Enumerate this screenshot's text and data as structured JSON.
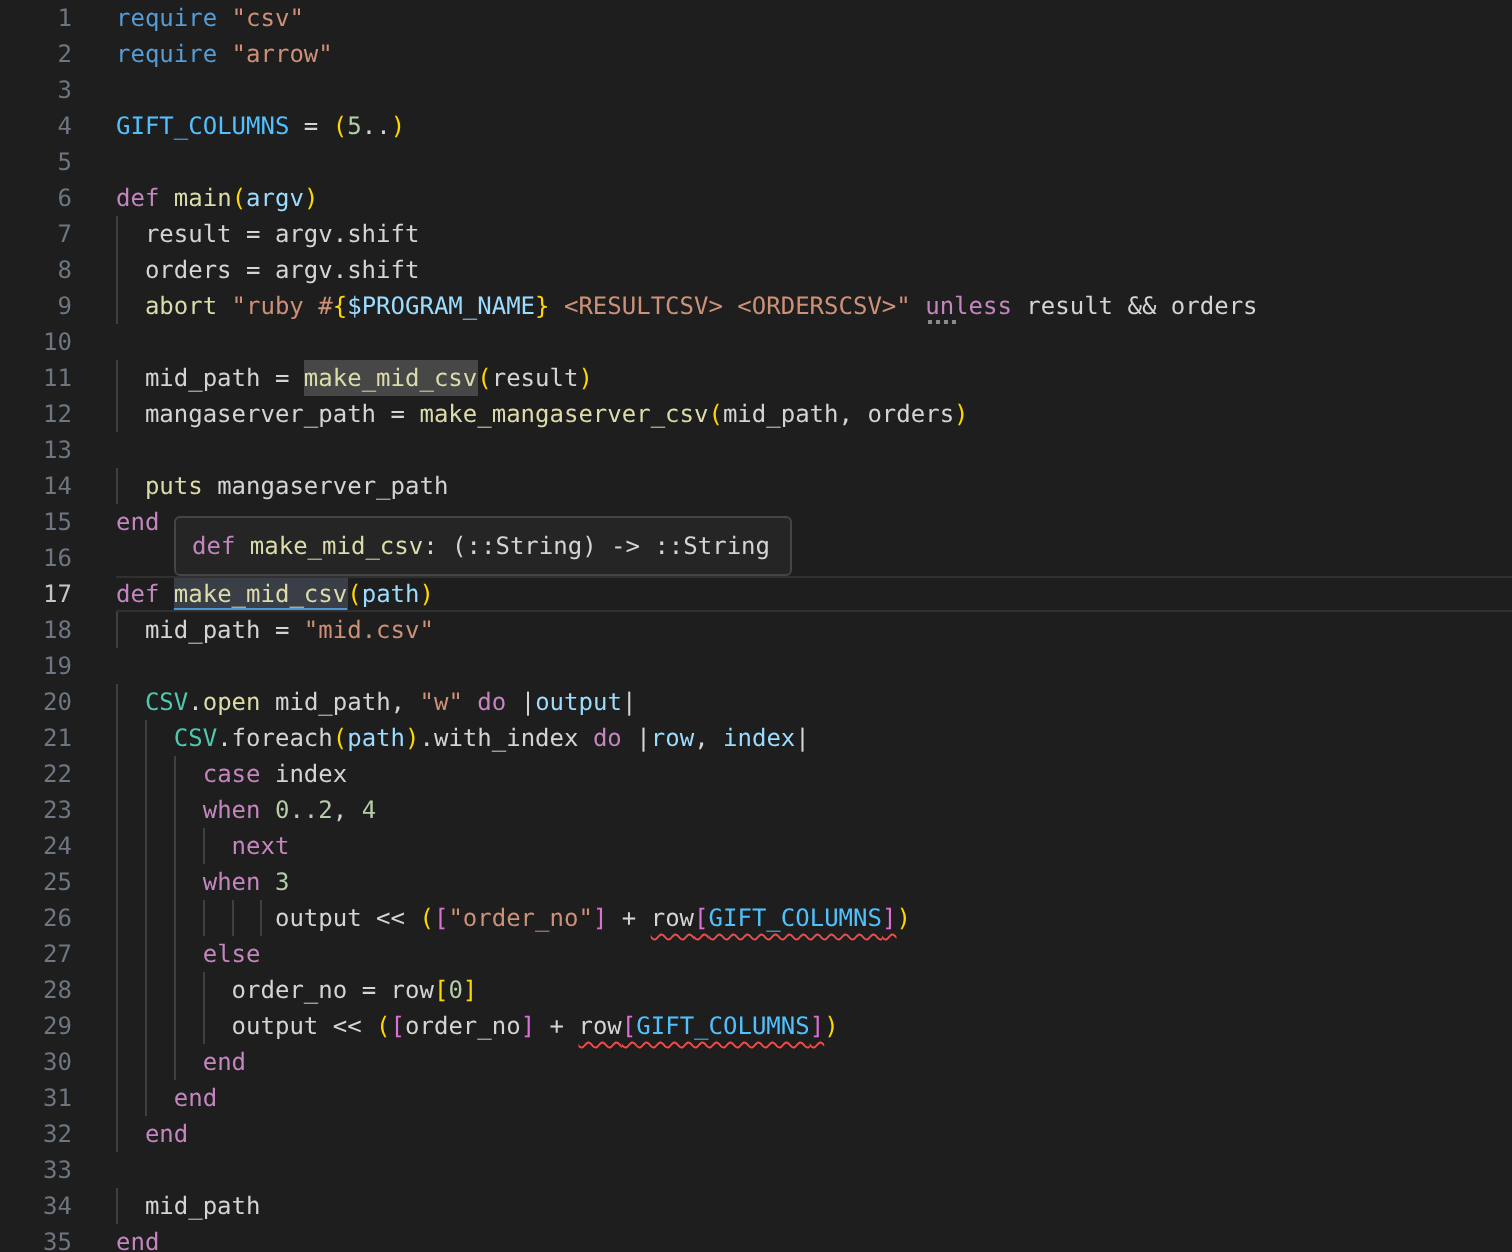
{
  "editor": {
    "lines": [
      {
        "number": "1",
        "current": false,
        "tokens": [
          {
            "text": "require",
            "kind": "req"
          },
          {
            "text": " \"csv\"",
            "kind": "str"
          }
        ]
      },
      {
        "number": "2",
        "current": false,
        "tokens": [
          {
            "text": "require",
            "kind": "req"
          },
          {
            "text": " \"arrow\"",
            "kind": "str"
          }
        ]
      },
      {
        "number": "3",
        "current": false
      },
      {
        "number": "4",
        "current": false,
        "tokens": [
          {
            "text": "GIFT_COLUMNS",
            "kind": "const"
          },
          {
            "text": " = ",
            "kind": "plain"
          },
          {
            "text": "(",
            "kind": "b1"
          },
          {
            "text": "5",
            "kind": "num"
          },
          {
            "text": "..",
            "kind": "plain"
          },
          {
            "text": ")",
            "kind": "b1"
          }
        ]
      },
      {
        "number": "5",
        "current": false
      },
      {
        "number": "6",
        "current": false,
        "tokens": [
          {
            "text": "def",
            "kind": "kw"
          },
          {
            "text": " main",
            "kind": "fn"
          },
          {
            "text": "(",
            "kind": "b1"
          },
          {
            "text": "argv",
            "kind": "param"
          },
          {
            "text": ")",
            "kind": "b1"
          }
        ]
      },
      {
        "number": "7",
        "current": false,
        "tokens": [
          {
            "text": "  result = argv.shift",
            "kind": "plain"
          }
        ]
      },
      {
        "number": "8",
        "current": false,
        "tokens": [
          {
            "text": "  orders = argv.shift",
            "kind": "plain"
          }
        ]
      },
      {
        "number": "9",
        "current": false,
        "tokens": [
          {
            "text": "  abort",
            "kind": "fn"
          },
          {
            "text": " \"ruby #",
            "kind": "str"
          },
          {
            "text": "{",
            "kind": "b1"
          },
          {
            "text": "$PROGRAM_NAME",
            "kind": "param"
          },
          {
            "text": "}",
            "kind": "b1"
          },
          {
            "text": " <RESULTCSV> <ORDERSCSV>\" ",
            "kind": "str"
          },
          {
            "text": "unless",
            "kind": "kw",
            "hint": true
          },
          {
            "text": " result && orders",
            "kind": "plain"
          }
        ]
      },
      {
        "number": "10",
        "current": false
      },
      {
        "number": "11",
        "current": false,
        "tokens": [
          {
            "text": "  mid_path = ",
            "kind": "plain"
          },
          {
            "text": "make_mid_csv",
            "kind": "fn",
            "highlight": true
          },
          {
            "text": "(",
            "kind": "b1"
          },
          {
            "text": "result",
            "kind": "plain"
          },
          {
            "text": ")",
            "kind": "b1"
          }
        ]
      },
      {
        "number": "12",
        "current": false,
        "tokens": [
          {
            "text": "  mangaserver_path = ",
            "kind": "plain"
          },
          {
            "text": "make_mangaserver_csv",
            "kind": "fn"
          },
          {
            "text": "(",
            "kind": "b1"
          },
          {
            "text": "mid_path, orders",
            "kind": "plain"
          },
          {
            "text": ")",
            "kind": "b1"
          }
        ]
      },
      {
        "number": "13",
        "current": false
      },
      {
        "number": "14",
        "current": false,
        "tokens": [
          {
            "text": "  puts",
            "kind": "fn"
          },
          {
            "text": " mangaserver_path",
            "kind": "plain"
          }
        ]
      },
      {
        "number": "15",
        "current": false,
        "tokens": [
          {
            "text": "end",
            "kind": "kw"
          }
        ]
      },
      {
        "number": "16",
        "current": false
      },
      {
        "number": "17",
        "current": true,
        "tokens": [
          {
            "text": "def ",
            "kind": "kw"
          },
          {
            "text": "make_mid_csv",
            "kind": "fn",
            "link": true
          },
          {
            "text": "(",
            "kind": "b1"
          },
          {
            "text": "path",
            "kind": "param"
          },
          {
            "text": ")",
            "kind": "b1"
          }
        ]
      },
      {
        "number": "18",
        "current": false,
        "tokens": [
          {
            "text": "  mid_path = ",
            "kind": "plain"
          },
          {
            "text": "\"mid.csv\"",
            "kind": "str"
          }
        ]
      },
      {
        "number": "19",
        "current": false
      },
      {
        "number": "20",
        "current": false,
        "tokens": [
          {
            "text": "  CSV",
            "kind": "type"
          },
          {
            "text": ".",
            "kind": "plain"
          },
          {
            "text": "open",
            "kind": "fn"
          },
          {
            "text": " mid_path, ",
            "kind": "plain"
          },
          {
            "text": "\"w\"",
            "kind": "str"
          },
          {
            "text": " do",
            "kind": "kw"
          },
          {
            "text": " |",
            "kind": "plain"
          },
          {
            "text": "output",
            "kind": "param"
          },
          {
            "text": "|",
            "kind": "plain"
          }
        ]
      },
      {
        "number": "21",
        "current": false,
        "tokens": [
          {
            "text": "    CSV",
            "kind": "type"
          },
          {
            "text": ".foreach",
            "kind": "plain"
          },
          {
            "text": "(",
            "kind": "b1"
          },
          {
            "text": "path",
            "kind": "param"
          },
          {
            "text": ")",
            "kind": "b1"
          },
          {
            "text": ".with_index",
            "kind": "plain"
          },
          {
            "text": " do",
            "kind": "kw"
          },
          {
            "text": " |",
            "kind": "plain"
          },
          {
            "text": "row",
            "kind": "param"
          },
          {
            "text": ", ",
            "kind": "plain"
          },
          {
            "text": "index",
            "kind": "param"
          },
          {
            "text": "|",
            "kind": "plain"
          }
        ]
      },
      {
        "number": "22",
        "current": false,
        "tokens": [
          {
            "text": "      case",
            "kind": "kw"
          },
          {
            "text": " index",
            "kind": "plain"
          }
        ]
      },
      {
        "number": "23",
        "current": false,
        "tokens": [
          {
            "text": "      when",
            "kind": "kw"
          },
          {
            "text": " 0..2",
            "kind": "num"
          },
          {
            "text": ", ",
            "kind": "plain"
          },
          {
            "text": "4",
            "kind": "num"
          }
        ]
      },
      {
        "number": "24",
        "current": false,
        "tokens": [
          {
            "text": "        next",
            "kind": "kw"
          }
        ]
      },
      {
        "number": "25",
        "current": false,
        "tokens": [
          {
            "text": "      when",
            "kind": "kw"
          },
          {
            "text": " 3",
            "kind": "num"
          }
        ]
      },
      {
        "number": "26",
        "current": false,
        "tokens": [
          {
            "text": "           output << ",
            "kind": "plain"
          },
          {
            "text": "(",
            "kind": "b1"
          },
          {
            "text": "[",
            "kind": "b2"
          },
          {
            "text": "\"order_no\"",
            "kind": "str"
          },
          {
            "text": "]",
            "kind": "b2"
          },
          {
            "text": " + ",
            "kind": "plain"
          },
          {
            "text": "row",
            "kind": "plain",
            "squiggle": true
          },
          {
            "text": "[",
            "kind": "b2",
            "squiggle": true
          },
          {
            "text": "GIFT_COLUMNS",
            "kind": "const",
            "squiggle": true
          },
          {
            "text": "]",
            "kind": "b2",
            "squiggle": true
          },
          {
            "text": ")",
            "kind": "b1"
          }
        ]
      },
      {
        "number": "27",
        "current": false,
        "tokens": [
          {
            "text": "      else",
            "kind": "kw"
          }
        ]
      },
      {
        "number": "28",
        "current": false,
        "tokens": [
          {
            "text": "        order_no = row",
            "kind": "plain"
          },
          {
            "text": "[",
            "kind": "b1"
          },
          {
            "text": "0",
            "kind": "num"
          },
          {
            "text": "]",
            "kind": "b1"
          }
        ]
      },
      {
        "number": "29",
        "current": false,
        "tokens": [
          {
            "text": "        output << ",
            "kind": "plain"
          },
          {
            "text": "(",
            "kind": "b1"
          },
          {
            "text": "[",
            "kind": "b2"
          },
          {
            "text": "order_no",
            "kind": "plain"
          },
          {
            "text": "]",
            "kind": "b2"
          },
          {
            "text": " + ",
            "kind": "plain"
          },
          {
            "text": "row",
            "kind": "plain",
            "squiggle": true
          },
          {
            "text": "[",
            "kind": "b2",
            "squiggle": true
          },
          {
            "text": "GIFT_COLUMNS",
            "kind": "const",
            "squiggle": true
          },
          {
            "text": "]",
            "kind": "b2",
            "squiggle": true
          },
          {
            "text": ")",
            "kind": "b1"
          }
        ]
      },
      {
        "number": "30",
        "current": false,
        "tokens": [
          {
            "text": "      end",
            "kind": "kw"
          }
        ]
      },
      {
        "number": "31",
        "current": false,
        "tokens": [
          {
            "text": "    end",
            "kind": "kw"
          }
        ]
      },
      {
        "number": "32",
        "current": false,
        "tokens": [
          {
            "text": "  end",
            "kind": "kw"
          }
        ]
      },
      {
        "number": "33",
        "current": false
      },
      {
        "number": "34",
        "current": false,
        "tokens": [
          {
            "text": "  mid_path",
            "kind": "plain"
          }
        ]
      },
      {
        "number": "35",
        "current": false,
        "tokens": [
          {
            "text": "end",
            "kind": "kw"
          }
        ]
      }
    ],
    "hover_tooltip": {
      "tokens": [
        {
          "text": "def",
          "kind": "kw"
        },
        {
          "text": " make_mid_csv",
          "kind": "fn"
        },
        {
          "text": ": (::String) -> ::String",
          "kind": "plain"
        }
      ]
    }
  }
}
